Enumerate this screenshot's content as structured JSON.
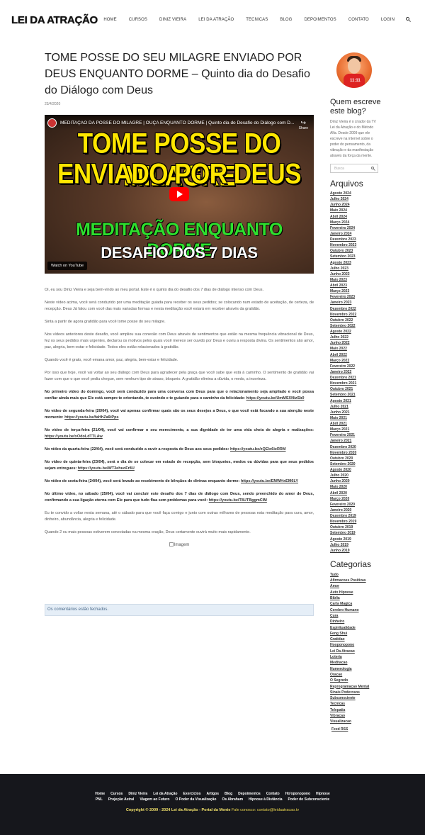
{
  "header": {
    "logo": "LEI DA ATRAÇÃO",
    "nav": [
      "HOME",
      "CURSOS",
      "DINIZ VIEIRA",
      "LEI DA ATRAÇÃO",
      "TECNICAS",
      "BLOG",
      "DEPOIMENTOS",
      "CONTATO",
      "LOGIN"
    ]
  },
  "post": {
    "title": "TOME POSSE DO SEU MILAGRE ENVIADO POR DEUS ENQUANTO DORME – Quinto dia do Desafio do Diálogo com Deus",
    "date": "23/4/2020",
    "video": {
      "title": "MEDITAÇÃO DA POSSE DO MILAGRE | OUÇA ENQUANTO DORME | Quinto dia do Desafio do Diálogo com D...",
      "share": "Share",
      "line1": "TOME POSSE DO MILAGRE",
      "line2": "ENVIADO POR DEUS",
      "line3": "MEDITAÇÃO ENQUANTO DORME",
      "line4": "DESAFIO DOS 7 DIAS",
      "watch": "Watch on  YouTube"
    },
    "p1": "Oi, eu sou Diniz Vieira e seja bem-vindo ao meu portal. Este é o quinto dia do desafio dos 7 dias de diálogo intenso com Deus.",
    "p2": "Neste vídeo acima, você será conduzido por uma meditação guiada para receber os seus pedidos; se colocando num estado de aceitação, de certeza, de recepção. Deus Já falou com você das mais variadas formas e nesta meditação você estará em receber através da gratidão.",
    "p3": "Sinta a partir de agora gratidão para você tome posse do seu milagre.",
    "p4": "Nos vídeos anteriores deste desafio, você ampliou sua conexão com Deus através de sentimentos que estão na mesma frequência vibracional de Deus, fez os seus pedidos mais urgentes, declarou os motivos pelos quais você merece ser ouvido por Deus e ouviu a resposta divina. Os sentimentos são amor, paz, alegria, bem-estar e felicidade. Todos eles estão relacionados à gratidão.",
    "p5": "Quando você é grato, você emana amor, paz, alegria, bem-estar e felicidade.",
    "p6": "Por isso que hoje, você vai voltar ao seu diálogo com Deus para agradecer pela graça que você sabe que está à caminho. O sentimento de gratidão vai fazer com que o que você pediu chegue, sem nenhum tipo de atraso, bloqueio. A gratidão elimina a dúvida, o medo, a incerteza.",
    "b1": "No primeiro vídeo do domingo, você será conduzido para uma conversa com Deus para que o relacionamento seja ampliado e você possa confiar ainda mais que Ele está sempre te orientando, te ouvindo e te guiando para o caminho da felicidade: ",
    "l1": "https://youtu.be/UmMSXNizSb0",
    "b2": "No vídeo de segunda-feira (20/04), você vai apenas confirmar quais são os seus desejos a Deus, o que você está focando a sua atenção neste momento: ",
    "l2": "https://youtu.be/faHhZa6tPps",
    "b3": "No vídeo de terça-feira (21/04), você vai confirmar o seu merecimento, a sua dignidade de ter uma vida cheia de alegria e realizações: ",
    "l3": "https://youtu.be/xOdoLdTTLAw",
    "b4": "No vídeo da quarta-feira (22/04), você será conduzido a ouvir a resposta de Deus aos seus pedidos: ",
    "l4": "https://youtu.be/zQEIo6ieRRM",
    "b5": "No vídeo de quinta-feira (23/04), será o dia de se colocar em estado de recepção, sem bloqueios, medos ou dúvidas para que seus pedidos sejam entregues: ",
    "l5": "https://youtu.be/WT3ehuoFr8U",
    "b6": "No vídeo de sexta-feira (24/04), você será levado ao recebimento de bênçãos de divinas enquanto dorme: ",
    "l6": "https://youtu.be/EMWHxEM6LY",
    "b7": "No último vídeo, no sábado (25/04), você vai concluir este desafio dos 7 dias de diálogo com Deus, sendo preenchido do amor de Deus, confirmando a sua ligação eterna com Ele para que tudo flua sem problemas para você: ",
    "l7": "https://youtu.be/T8UTBggmCIM",
    "p7": "Eu te convido a voltar nesta semana, até o sábado para que você faça comigo e junto com outras milhares de pessoas esta meditação para cura, amor, dinheiro, abundância, alegria e felicidade.",
    "p8": "Quando 2 ou mais pessoas estiverem conectadas na mesma oração, Deus certamente ouvirá muito mais rapidamente.",
    "img_alt": "Imagem",
    "comments": "Os comentários estão fechados."
  },
  "sidebar": {
    "avatar_text": "11:11",
    "about_title": "Quem escreve este blog?",
    "about_text": "Diniz Vieira é o criador da TV Lei da Atração e do Método Alfa. Desde 2009 que ele escreve na internet sobre o poder do pensamento, da vibração e da manifestação através da força da mente.",
    "search_placeholder": "Busca",
    "archive_title": "Arquivos",
    "archive": [
      "Agosto 2024",
      "Julho 2024",
      "Junho 2024",
      "Maio 2024",
      "Abril 2024",
      "Março 2024",
      "Fevereiro 2024",
      "Janeiro 2024",
      "Dezembro 2023",
      "Novembro 2023",
      "Outubro 2023",
      "Setembro 2023",
      "Agosto 2023",
      "Julho 2023",
      "Junho 2023",
      "Maio 2023",
      "Abril 2023",
      "Março 2023",
      "Fevereiro 2023",
      "Janeiro 2023",
      "Dezembro 2022",
      "Novembro 2022",
      "Outubro 2022",
      "Setembro 2022",
      "Agosto 2022",
      "Julho 2022",
      "Junho 2022",
      "Maio 2022",
      "Abril 2022",
      "Março 2022",
      "Fevereiro 2022",
      "Janeiro 2022",
      "Dezembro 2021",
      "Novembro 2021",
      "Outubro 2021",
      "Setembro 2021",
      "Agosto 2021",
      "Julho 2021",
      "Junho 2021",
      "Maio 2021",
      "Abril 2021",
      "Março 2021",
      "Fevereiro 2021",
      "Janeiro 2021",
      "Dezembro 2020",
      "Novembro 2020",
      "Outubro 2020",
      "Setembro 2020",
      "Agosto 2020",
      "Julho 2020",
      "Junho 2020",
      "Maio 2020",
      "Abril 2020",
      "Março 2020",
      "Fevereiro 2020",
      "Janeiro 2020",
      "Dezembro 2019",
      "Novembro 2019",
      "Outubro 2019",
      "Setembro 2019",
      "Agosto 2019",
      "Julho 2019",
      "Junho 2019"
    ],
    "categories_title": "Categorias",
    "categories": [
      "Tudo",
      "Afirmacoes Positivas",
      "Amor",
      "Auto Hipnose",
      "Biblia",
      "Carta Magica",
      "Cerebro Humano",
      "Cura",
      "Dinheiro",
      "Espiritualidade",
      "Feng Shui",
      "Gratidao",
      "Hooponopono",
      "Lei Da Atracao",
      "Loteria",
      "Meditacao",
      "Numerologia",
      "Oracao",
      "O Segredo",
      "Reprogramacao Mental",
      "Sinais Poderosos",
      "Subconsciente",
      "Tecnicas",
      "Telepatia",
      "Vibracao",
      "Visualizacao"
    ],
    "feed": "Feed RSS"
  },
  "footer": {
    "row1": [
      "Home",
      "Cursos",
      "Diniz Vieira",
      "Lei da Atração",
      "Exercícios",
      "Artigos",
      "Blog",
      "Depoimentos",
      "Contato",
      "Ho'oponopono",
      "Hipnose"
    ],
    "row2": [
      "PNL",
      "Projeção Astral",
      "Viagem ao Futuro",
      "O Poder da Visualização",
      "Os Abraham",
      "Hipnose à Distância",
      "Poder do Subconsciente"
    ],
    "copyright": "Copyright © 2009 - 2024 Lei da Atração - Portal da Mente",
    "contact": " Fale conosco: contato@leidaatracao.tv"
  }
}
